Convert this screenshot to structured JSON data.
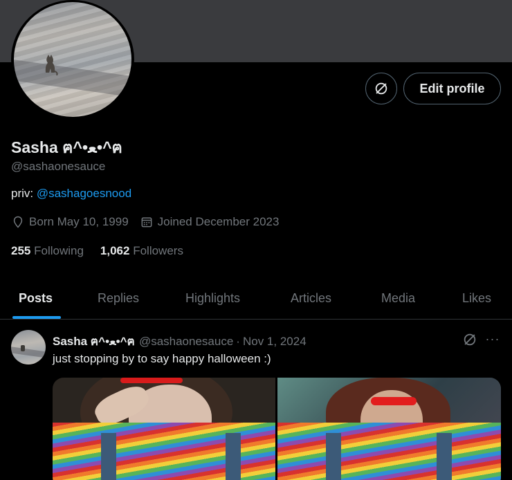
{
  "profile": {
    "name": "Sasha ฅ^•ﻌ•^ฅ",
    "handle": "@sashaonesauce",
    "bio_prefix": "priv: ",
    "bio_link": "@sashagoesnood",
    "born": "Born May 10, 1999",
    "joined": "Joined December 2023",
    "following_count": "255",
    "following_label": "Following",
    "followers_count": "1,062",
    "followers_label": "Followers"
  },
  "actions": {
    "edit_profile": "Edit profile"
  },
  "tabs": [
    {
      "label": "Posts",
      "active": true
    },
    {
      "label": "Replies",
      "active": false
    },
    {
      "label": "Highlights",
      "active": false
    },
    {
      "label": "Articles",
      "active": false
    },
    {
      "label": "Media",
      "active": false
    },
    {
      "label": "Likes",
      "active": false
    }
  ],
  "post": {
    "name": "Sasha ฅ^•ﻌ•^ฅ",
    "handle": "@sashaonesauce",
    "separator": "·",
    "date": "Nov 1, 2024",
    "text": "just stopping by to say happy halloween :)",
    "more": "···"
  },
  "colors": {
    "background": "#000000",
    "banner": "#3a3b3e",
    "accent": "#1d9bf0",
    "primary_text": "#e7e9ea",
    "secondary_text": "#71767b",
    "border": "#2f3336"
  },
  "icons": {
    "location": "location-pin-icon",
    "calendar": "calendar-icon",
    "unlinked": "slash-circle-icon",
    "more": "more-horizontal-icon"
  }
}
